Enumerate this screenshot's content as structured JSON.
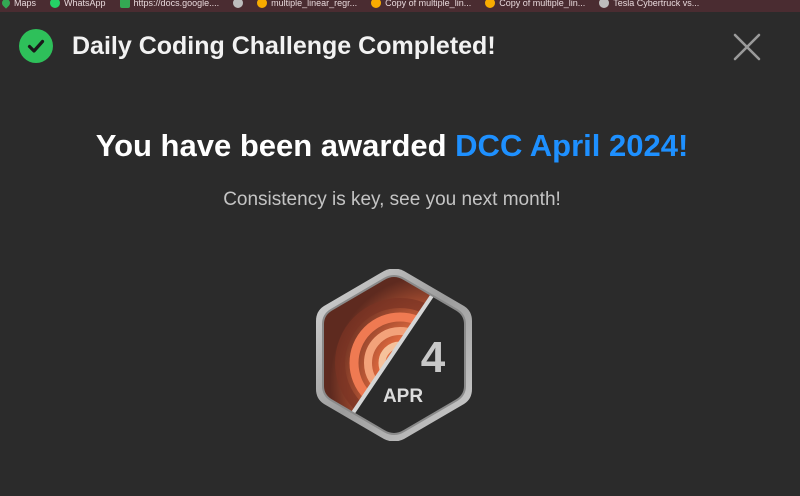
{
  "bookmarks": [
    {
      "icon": "maps-icon",
      "label": "Maps"
    },
    {
      "icon": "whatsapp-icon",
      "label": "WhatsApp"
    },
    {
      "icon": "google-docs-icon",
      "label": "https://docs.google...."
    },
    {
      "icon": "globe-icon",
      "label": ""
    },
    {
      "icon": "colab-icon",
      "label": "multiple_linear_regr..."
    },
    {
      "icon": "colab-icon",
      "label": "Copy of multiple_lin..."
    },
    {
      "icon": "colab-icon",
      "label": "Copy of multiple_lin..."
    },
    {
      "icon": "globe-icon",
      "label": "Tesla Cybertruck vs..."
    }
  ],
  "dialog": {
    "title": "Daily Coding Challenge Completed!",
    "award_prefix": "You have been awarded ",
    "award_name": "DCC April 2024!",
    "subtitle": "Consistency is key, see you next month!",
    "badge": {
      "day": "4",
      "month": "APR"
    }
  },
  "colors": {
    "accent": "#1e90ff",
    "success": "#2ec05a",
    "background": "#2b2b2b",
    "bookmark_bar": "#4a2c31"
  }
}
